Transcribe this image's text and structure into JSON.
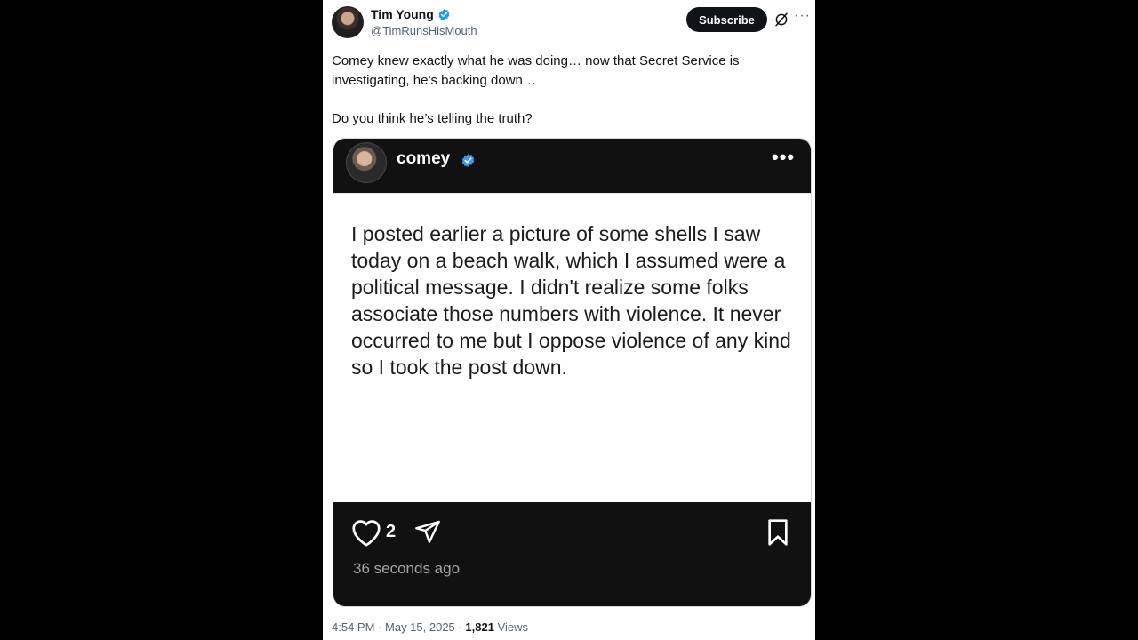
{
  "author": {
    "name": "Tim Young",
    "handle": "@TimRunsHisMouth"
  },
  "actions": {
    "subscribe_label": "Subscribe",
    "more_label": "···"
  },
  "tweet": {
    "paragraph1": "Comey knew exactly what he was doing… now that Secret Service is investigating, he’s backing down…",
    "paragraph2": "Do you think he’s telling the truth?"
  },
  "embedded": {
    "username": "comey",
    "more_label": "•••",
    "body": "I posted earlier a picture of some shells I saw today on a beach walk, which I assumed were a political message. I didn't realize some folks associate those numbers with violence. It never occurred to me but I oppose violence of any kind so I took the post down.",
    "likes": "2",
    "time": "36 seconds ago"
  },
  "meta": {
    "time": "4:54 PM",
    "date": "May 15, 2025",
    "views_count": "1,821",
    "views_label": "Views",
    "sep": "·"
  },
  "colors": {
    "verified": "#1d9bf0",
    "subscribe_bg": "#0f1419",
    "card_dark": "#111111"
  },
  "icons": [
    "verified-badge-icon",
    "grok-icon",
    "more-icon",
    "heart-icon",
    "send-icon",
    "bookmark-icon"
  ]
}
